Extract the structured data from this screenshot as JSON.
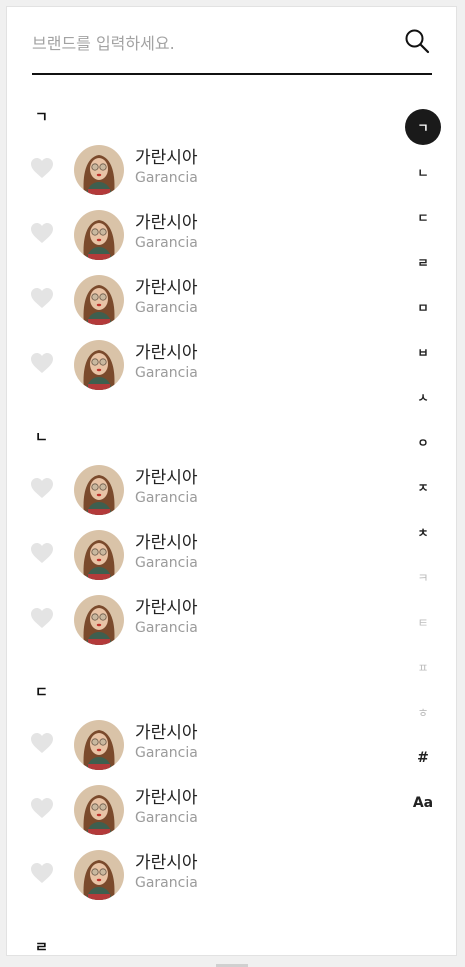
{
  "search": {
    "placeholder": "브랜드를 입력하세요.",
    "value": ""
  },
  "sections": [
    {
      "letter": "ㄱ",
      "brands": [
        {
          "ko": "가란시아",
          "en": "Garancia",
          "liked": false
        },
        {
          "ko": "가란시아",
          "en": "Garancia",
          "liked": false
        },
        {
          "ko": "가란시아",
          "en": "Garancia",
          "liked": false
        },
        {
          "ko": "가란시아",
          "en": "Garancia",
          "liked": false
        }
      ]
    },
    {
      "letter": "ㄴ",
      "brands": [
        {
          "ko": "가란시아",
          "en": "Garancia",
          "liked": false
        },
        {
          "ko": "가란시아",
          "en": "Garancia",
          "liked": false
        },
        {
          "ko": "가란시아",
          "en": "Garancia",
          "liked": false
        }
      ]
    },
    {
      "letter": "ㄷ",
      "brands": [
        {
          "ko": "가란시아",
          "en": "Garancia",
          "liked": false
        },
        {
          "ko": "가란시아",
          "en": "Garancia",
          "liked": false
        },
        {
          "ko": "가란시아",
          "en": "Garancia",
          "liked": false
        }
      ]
    },
    {
      "letter": "ㄹ",
      "brands": []
    }
  ],
  "index": {
    "active": "ㄱ",
    "items": [
      {
        "label": "ㄱ",
        "enabled": true
      },
      {
        "label": "ㄴ",
        "enabled": true
      },
      {
        "label": "ㄷ",
        "enabled": true
      },
      {
        "label": "ㄹ",
        "enabled": true
      },
      {
        "label": "ㅁ",
        "enabled": true
      },
      {
        "label": "ㅂ",
        "enabled": true
      },
      {
        "label": "ㅅ",
        "enabled": true
      },
      {
        "label": "ㅇ",
        "enabled": true
      },
      {
        "label": "ㅈ",
        "enabled": true
      },
      {
        "label": "ㅊ",
        "enabled": true
      },
      {
        "label": "ㅋ",
        "enabled": false
      },
      {
        "label": "ㅌ",
        "enabled": false
      },
      {
        "label": "ㅍ",
        "enabled": false
      },
      {
        "label": "ㅎ",
        "enabled": false
      },
      {
        "label": "#",
        "enabled": true
      },
      {
        "label": "Aa",
        "enabled": true
      }
    ]
  },
  "colors": {
    "heart": "#e4e4e4",
    "accent": "#1a1a1a",
    "secondary_text": "#9b9b9b"
  },
  "icons": {
    "search": "search-icon",
    "heart": "heart-icon"
  }
}
